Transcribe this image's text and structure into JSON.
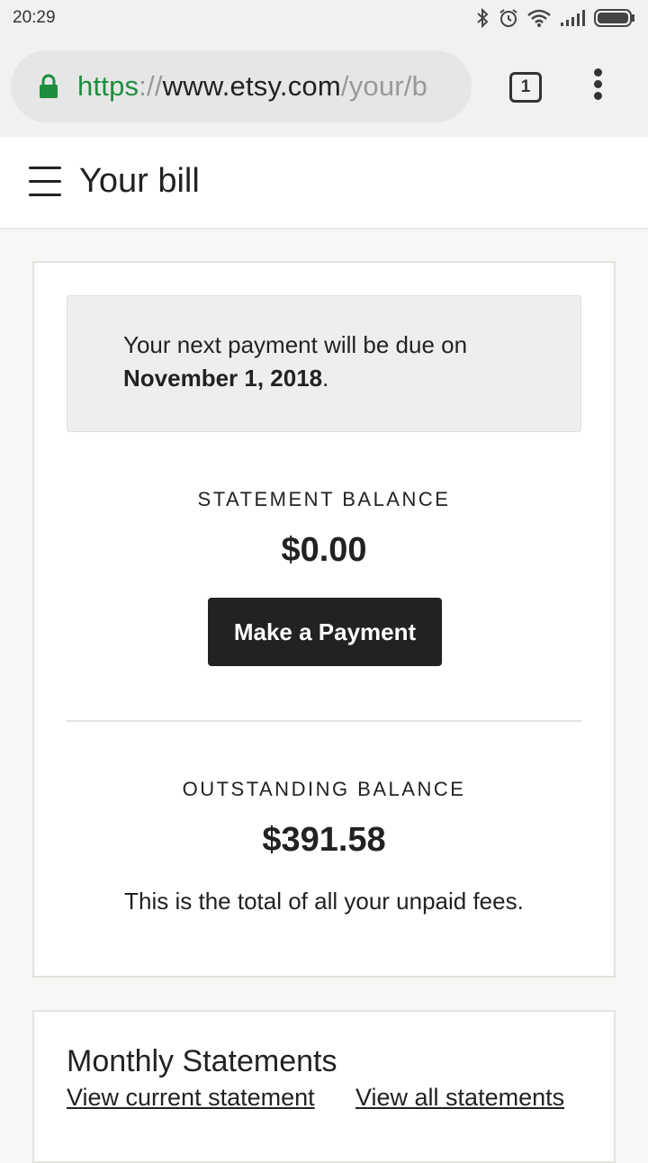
{
  "status_bar": {
    "time": "20:29"
  },
  "browser": {
    "url_scheme": "https",
    "url_sep": "://",
    "url_host": "www.etsy.com",
    "url_path": "/your/b",
    "tab_count": "1"
  },
  "header": {
    "title": "Your bill"
  },
  "notice": {
    "text": "Your next payment will be due on",
    "date": "November 1, 2018",
    "suffix": "."
  },
  "statement": {
    "label": "STATEMENT BALANCE",
    "amount": "$0.00",
    "button_label": "Make a Payment"
  },
  "outstanding": {
    "label": "OUTSTANDING BALANCE",
    "amount": "$391.58",
    "description": "This is the total of all your unpaid fees."
  },
  "monthly": {
    "title": "Monthly Statements",
    "current_link": "View current statement",
    "all_link": "View all statements"
  },
  "colors": {
    "secure_green": "#1e8e3e",
    "button_bg": "#222222"
  }
}
